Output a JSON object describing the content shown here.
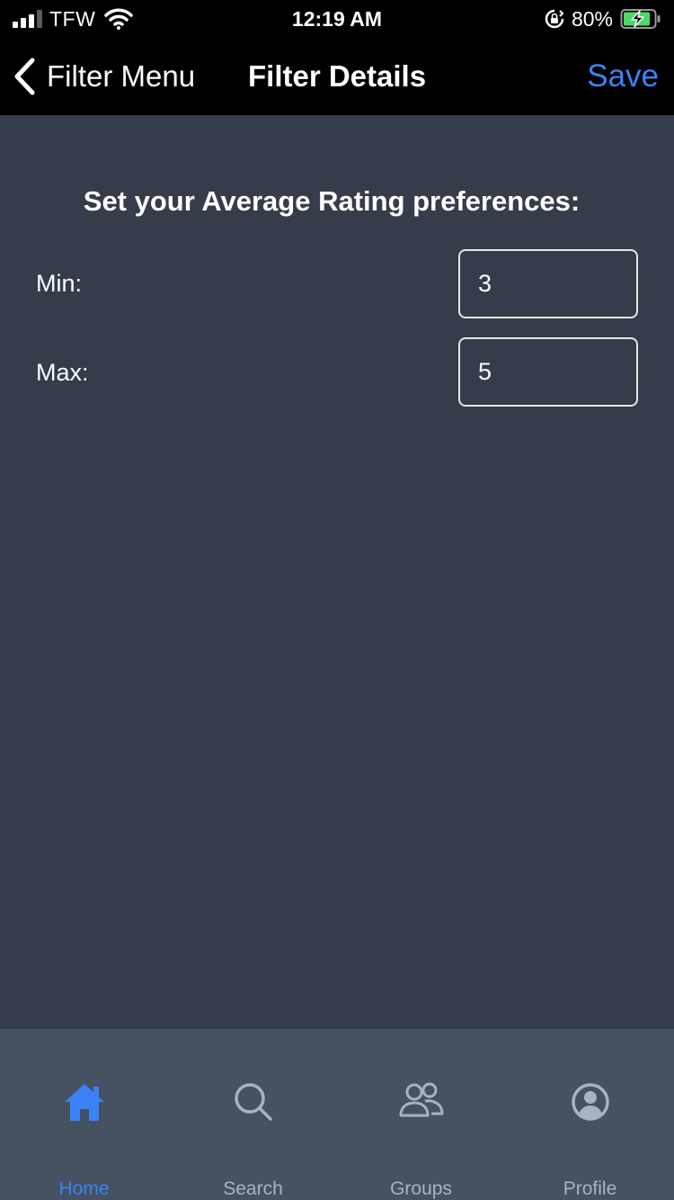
{
  "status_bar": {
    "carrier": "TFW",
    "time": "12:19 AM",
    "battery_percent": "80%",
    "signal_bars": 4,
    "signal_strength": 3,
    "battery_level": 0.8,
    "charging": true
  },
  "nav": {
    "back_label": "Filter Menu",
    "title": "Filter Details",
    "save_label": "Save"
  },
  "content": {
    "heading": "Set your Average Rating preferences:",
    "min_label": "Min:",
    "min_value": "3",
    "max_label": "Max:",
    "max_value": "5"
  },
  "tabs": [
    {
      "label": "Home",
      "icon": "home-icon",
      "active": true
    },
    {
      "label": "Search",
      "icon": "search-icon",
      "active": false
    },
    {
      "label": "Groups",
      "icon": "groups-icon",
      "active": false
    },
    {
      "label": "Profile",
      "icon": "profile-icon",
      "active": false
    }
  ],
  "colors": {
    "accent": "#3b82f6",
    "background": "#343d49",
    "tab_bar": "#465162",
    "bars": "#000000"
  }
}
